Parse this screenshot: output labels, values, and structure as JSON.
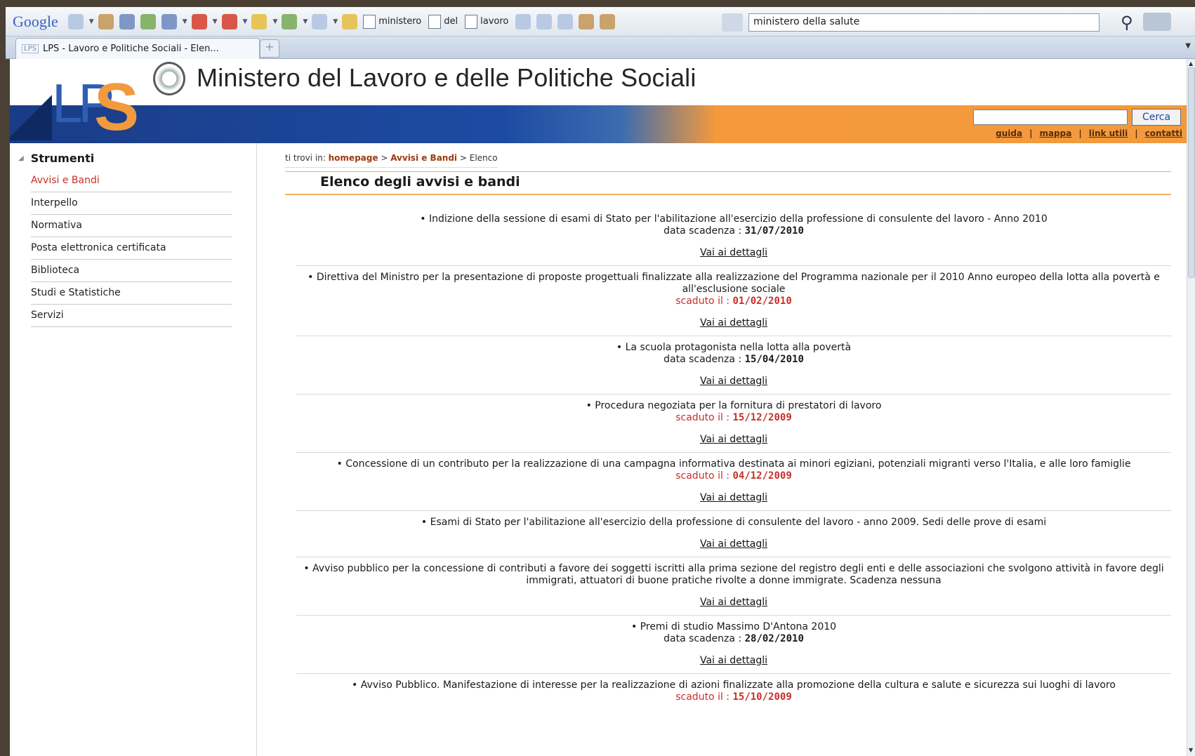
{
  "browser": {
    "toolbar": {
      "logo": "Google",
      "quick_buttons": [
        "ministero",
        "del",
        "lavoro"
      ],
      "search_value": "ministero della salute"
    },
    "tab": {
      "favicon": "LPS",
      "title": "LPS - Lavoro e Politiche Sociali - Elen..."
    }
  },
  "header": {
    "logo_text_l": "LP",
    "logo_text_s": "S",
    "site_title": "Ministero del Lavoro e delle Politiche Sociali",
    "search_button": "Cerca",
    "links": [
      "guida",
      "mappa",
      "link utili",
      "contatti"
    ]
  },
  "sidebar": {
    "heading": "Strumenti",
    "items": [
      "Avvisi e Bandi",
      "Interpello",
      "Normativa",
      "Posta elettronica certificata",
      "Biblioteca",
      "Studi e Statistiche",
      "Servizi"
    ]
  },
  "breadcrumb": {
    "prefix": "ti trovi in:",
    "path": [
      "homepage",
      "Avvisi e Bandi"
    ],
    "current": "Elenco"
  },
  "main": {
    "title": "Elenco degli avvisi e bandi",
    "details_label": "Vai ai dettagli",
    "items": [
      {
        "title": "Indizione della sessione di esami di Stato per l'abilitazione all'esercizio della professione di consulente del lavoro - Anno 2010",
        "date_label": "data scadenza :",
        "date": "31/07/2010",
        "expired": false
      },
      {
        "title": "Direttiva del Ministro per la presentazione di proposte progettuali finalizzate alla realizzazione del Programma nazionale per il 2010 Anno europeo della lotta alla povertà e all'esclusione sociale",
        "date_label": "scaduto il :",
        "date": "01/02/2010",
        "expired": true
      },
      {
        "title": "La scuola protagonista nella lotta alla povertà",
        "date_label": "data scadenza :",
        "date": "15/04/2010",
        "expired": false
      },
      {
        "title": "Procedura negoziata per la fornitura di prestatori di lavoro",
        "date_label": "scaduto il :",
        "date": "15/12/2009",
        "expired": true
      },
      {
        "title": "Concessione di un contributo per la realizzazione di una campagna informativa destinata ai minori egiziani, potenziali migranti verso l'Italia, e alle loro famiglie",
        "date_label": "scaduto il :",
        "date": "04/12/2009",
        "expired": true
      },
      {
        "title": "Esami di Stato per l'abilitazione all'esercizio della professione di consulente del lavoro - anno 2009. Sedi delle prove di esami",
        "date_label": "",
        "date": "",
        "expired": false
      },
      {
        "title": "Avviso pubblico per la concessione di contributi a favore dei soggetti iscritti alla prima sezione del registro degli enti e delle associazioni che svolgono attività in favore degli immigrati, attuatori di buone pratiche rivolte a donne immigrate. Scadenza nessuna",
        "date_label": "",
        "date": "",
        "expired": false
      },
      {
        "title": "Premi di studio Massimo D'Antona 2010",
        "date_label": "data scadenza :",
        "date": "28/02/2010",
        "expired": false
      },
      {
        "title": "Avviso Pubblico. Manifestazione di interesse per la realizzazione di azioni finalizzate alla promozione della cultura e salute e sicurezza sui luoghi di lavoro",
        "date_label": "scaduto il :",
        "date": "15/10/2009",
        "expired": true
      }
    ]
  },
  "colors": {
    "brand_blue": "#1d4ba3",
    "brand_orange": "#f29a3d",
    "expired_red": "#c6302a"
  }
}
